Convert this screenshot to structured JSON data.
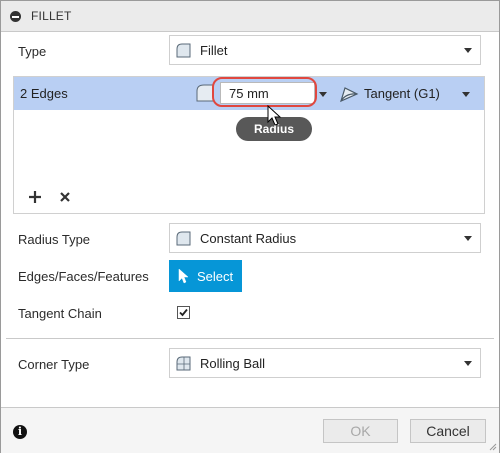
{
  "title": "FILLET",
  "type": {
    "label": "Type",
    "value": "Fillet"
  },
  "edges": {
    "selection_label": "2 Edges",
    "radius_value": "75 mm",
    "tangency": "Tangent (G1)",
    "tooltip": "Radius"
  },
  "radius_type": {
    "label": "Radius Type",
    "value": "Constant Radius"
  },
  "edges_faces": {
    "label": "Edges/Faces/Features",
    "button": "Select"
  },
  "tangent_chain": {
    "label": "Tangent Chain",
    "checked": true
  },
  "corner_type": {
    "label": "Corner Type",
    "value": "Rolling Ball"
  },
  "footer": {
    "ok": "OK",
    "cancel": "Cancel"
  },
  "colors": {
    "selected_row": "#b9cff3",
    "select_button": "#0696d7",
    "highlight": "#e0473f"
  },
  "icons": [
    "collapse-icon",
    "fillet-type-icon",
    "radius-shape-icon",
    "tangent-icon",
    "add-icon",
    "remove-icon",
    "cursor-icon",
    "constant-radius-icon",
    "select-arrow-icon",
    "checkmark-icon",
    "rolling-ball-icon",
    "info-icon"
  ]
}
